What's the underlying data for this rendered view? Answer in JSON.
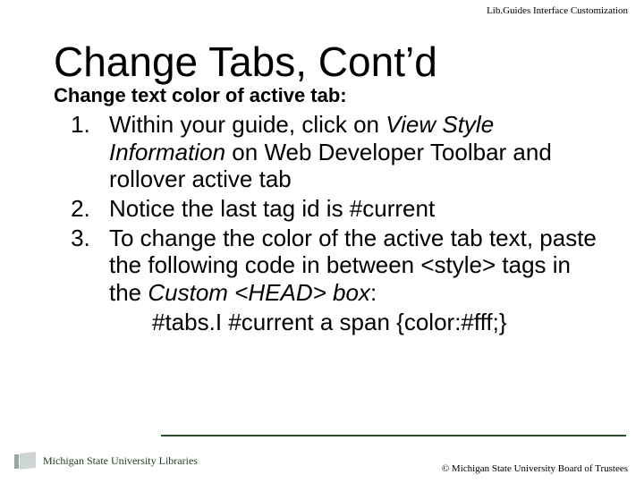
{
  "header": {
    "label": "Lib.Guides Interface Customization"
  },
  "title": "Change Tabs, Cont’d",
  "subtitle": "Change text color of active tab:",
  "steps": {
    "s1a": "Within your guide, click on ",
    "s1b": "View Style Information",
    "s1c": " on Web Developer Toolbar and rollover active tab",
    "s2": "Notice the last tag id is #current",
    "s3a": "To change the color of the active tab text, paste the following code in between <style> tags in the ",
    "s3b": "Custom <HEAD> box",
    "s3c": ":",
    "code": "#tabs.I #current a span {color:#fff;}"
  },
  "footer": {
    "logo_text": "Michigan State University Libraries",
    "copyright": "© Michigan State University Board of Trustees"
  }
}
